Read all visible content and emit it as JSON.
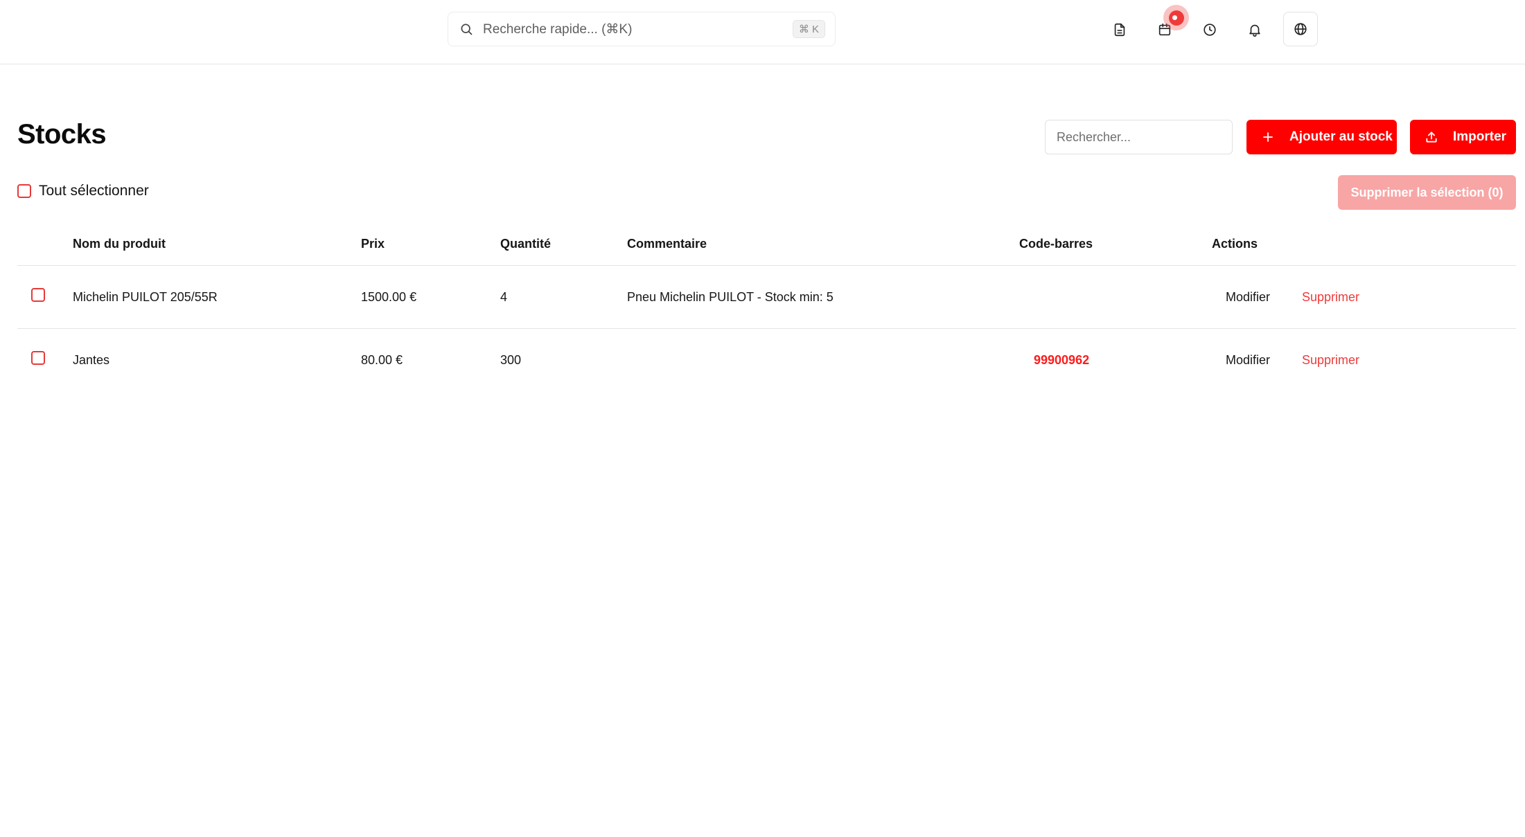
{
  "topbar": {
    "quick_search_placeholder": "Recherche rapide... (⌘K)",
    "quick_search_shortcut": "⌘ K",
    "icons": [
      "document-icon",
      "calendar-icon",
      "clock-icon",
      "bell-icon",
      "globe-icon"
    ]
  },
  "page": {
    "title": "Stocks",
    "search_placeholder": "Rechercher...",
    "add_button_label": "Ajouter au stock",
    "import_button_label": "Importer",
    "select_all_label": "Tout sélectionner",
    "delete_selection_label": "Supprimer la sélection (0)"
  },
  "table": {
    "columns": {
      "name": "Nom du produit",
      "price": "Prix",
      "quantity": "Quantité",
      "comment": "Commentaire",
      "barcode": "Code-barres",
      "actions": "Actions"
    },
    "rows": [
      {
        "name": "Michelin PUILOT 205/55R",
        "price": "1500.00 €",
        "quantity": "4",
        "comment": "Pneu Michelin PUILOT - Stock min: 5",
        "barcode": "",
        "edit": "Modifier",
        "delete": "Supprimer"
      },
      {
        "name": "Jantes",
        "price": "80.00 €",
        "quantity": "300",
        "comment": "",
        "barcode": "99900962",
        "edit": "Modifier",
        "delete": "Supprimer"
      }
    ]
  },
  "colors": {
    "accent": "#ff0000",
    "accent_disabled": "#f8a5a5",
    "link_red": "#ef3a3a"
  }
}
